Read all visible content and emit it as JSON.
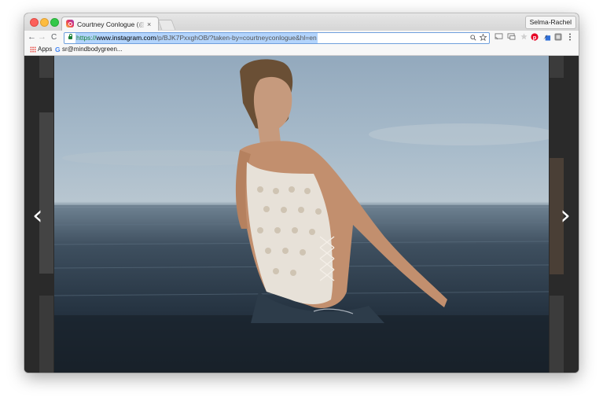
{
  "browser": {
    "tab": {
      "title": "Courtney Conlogue (@courtne",
      "close_glyph": "×"
    },
    "profile_name": "Selma-Rachel",
    "nav": {
      "back": "←",
      "forward": "→",
      "reload": "C"
    },
    "address": {
      "scheme": "https://",
      "host": "www.instagram.com",
      "path": "/p/BJK7PxxghOB/?taken-by=courtneyconlogue&hl=en",
      "zoom_icon": "zoom-icon",
      "star_icon": "bookmark-star-icon"
    },
    "bookmarks": [
      {
        "label": "Apps",
        "icon": "apps-grid-icon"
      },
      {
        "label": "sr@mindbodygreen...",
        "icon": "google-g-icon"
      }
    ]
  },
  "viewer": {
    "prev_glyph": "‹",
    "next_glyph": "›"
  },
  "colors": {
    "url_selection": "#b3d4fc",
    "secure_green": "#188038",
    "overlay": "#2a2a2a"
  }
}
